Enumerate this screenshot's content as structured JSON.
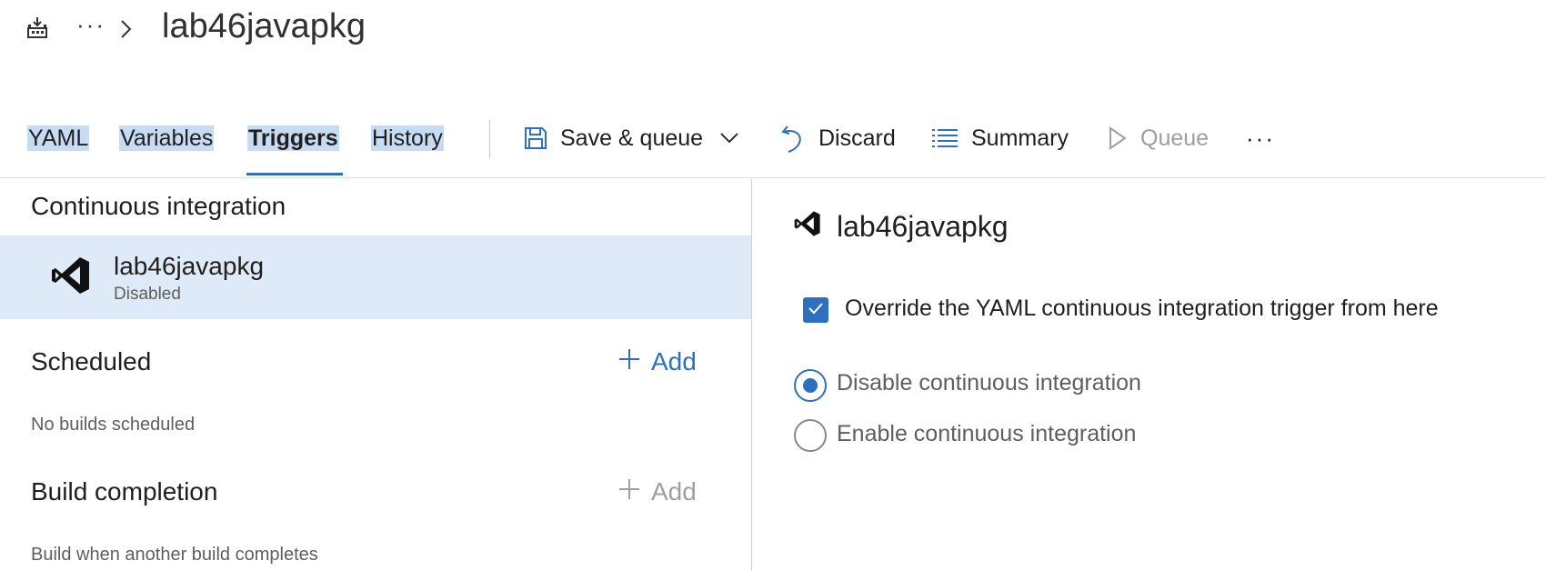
{
  "header": {
    "more_label": "···",
    "title": "lab46javapkg",
    "icons": {
      "pipeline": "pipeline-icon",
      "chevron": "chevron-right-icon"
    }
  },
  "tabs": [
    {
      "label": "YAML",
      "active": false
    },
    {
      "label": "Variables",
      "active": false
    },
    {
      "label": "Triggers",
      "active": true
    },
    {
      "label": "History",
      "active": false
    }
  ],
  "toolbar": {
    "save_queue": "Save & queue",
    "discard": "Discard",
    "summary": "Summary",
    "queue": "Queue",
    "more": "···",
    "queue_disabled": true
  },
  "left": {
    "ci_title": "Continuous integration",
    "ci_item": {
      "name": "lab46javapkg",
      "status": "Disabled"
    },
    "scheduled_title": "Scheduled",
    "scheduled_add": "Add",
    "scheduled_empty": "No builds scheduled",
    "build_completion_title": "Build completion",
    "build_completion_add": "Add",
    "build_completion_desc": "Build when another build completes"
  },
  "right": {
    "title": "lab46javapkg",
    "override_label": "Override the YAML continuous integration trigger from here",
    "override_checked": true,
    "options": [
      {
        "label": "Disable continuous integration",
        "selected": true
      },
      {
        "label": "Enable continuous integration",
        "selected": false
      }
    ]
  },
  "colors": {
    "accent": "#2f6fc0",
    "selected_row": "#deeaf7",
    "tab_highlight": "#c7dcf2",
    "disabled_text": "#a19f9d"
  }
}
